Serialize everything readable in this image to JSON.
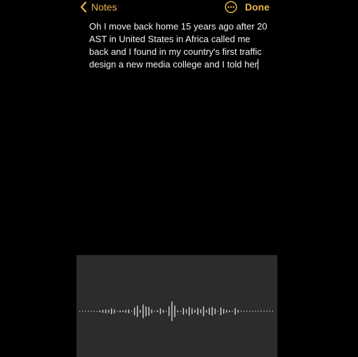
{
  "colors": {
    "accent": "#e9b64b",
    "background": "#000000",
    "dictation_panel": "#2c2c2e",
    "waveform": "#d9d9d9"
  },
  "nav": {
    "back_icon": "chevron-left-icon",
    "back_label": "Notes",
    "more_icon": "ellipsis-circle-icon",
    "done_label": "Done"
  },
  "note": {
    "lines": [
      "Oh I move back home 15 years ago after 20",
      "AST in United States in Africa called me",
      "back and I found in my country's first traffic",
      "design a new media college and I told her"
    ]
  },
  "dictation": {
    "icon": "waveform-icon",
    "levels": [
      0.05,
      0.05,
      0.05,
      0.05,
      0.05,
      0.05,
      0.05,
      0.1,
      0.15,
      0.2,
      0.15,
      0.3,
      0.2,
      0.05,
      0.1,
      0.1,
      0.15,
      0.2,
      0.05,
      0.4,
      0.6,
      0.15,
      0.7,
      0.5,
      0.45,
      0.2,
      0.05,
      0.1,
      0.3,
      0.15,
      0.05,
      0.5,
      1.0,
      0.6,
      0.1,
      0.05,
      0.35,
      0.2,
      0.45,
      0.3,
      0.15,
      0.35,
      0.2,
      0.5,
      0.15,
      0.35,
      0.45,
      0.3,
      0.05,
      0.4,
      0.25,
      0.15,
      0.1,
      0.05,
      0.35,
      0.15,
      0.05,
      0.05,
      0.05,
      0.05,
      0.05,
      0.05,
      0.05,
      0.05,
      0.05,
      0.05,
      0.05,
      0.05
    ]
  }
}
